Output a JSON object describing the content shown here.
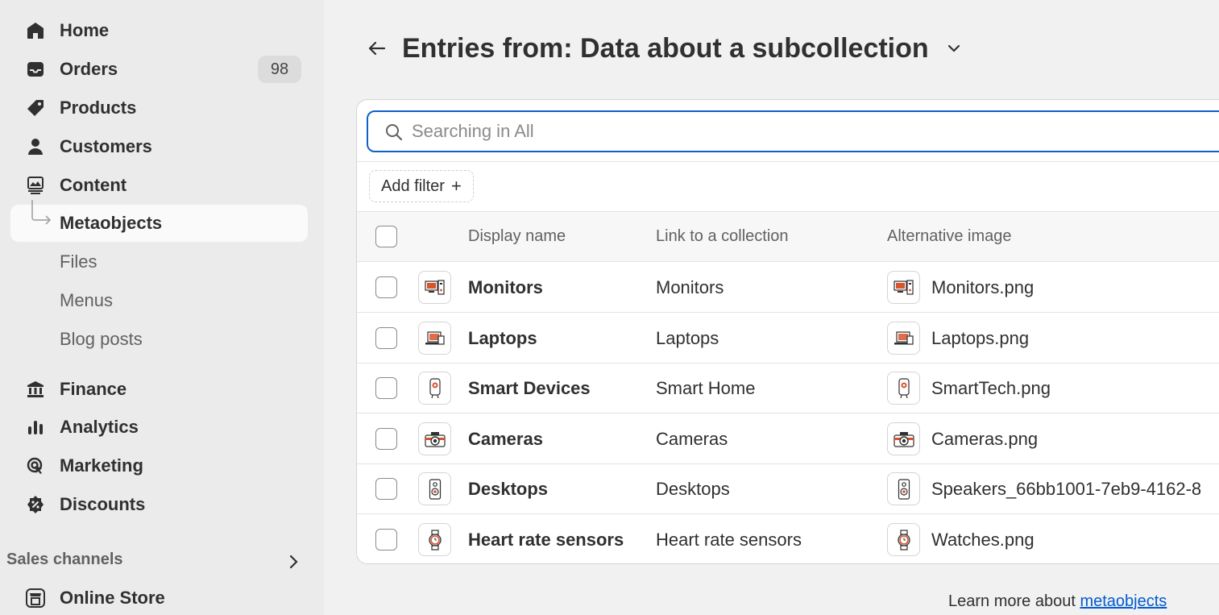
{
  "sidebar": {
    "items": [
      {
        "label": "Home",
        "icon": "home-icon"
      },
      {
        "label": "Orders",
        "icon": "inbox-icon",
        "badge": "98"
      },
      {
        "label": "Products",
        "icon": "tag-icon"
      },
      {
        "label": "Customers",
        "icon": "person-icon"
      },
      {
        "label": "Content",
        "icon": "image-icon"
      },
      {
        "label": "Metaobjects",
        "icon": "subitem-arrow-icon",
        "active": true
      },
      {
        "label": "Files"
      },
      {
        "label": "Menus"
      },
      {
        "label": "Blog posts"
      },
      {
        "label": "Finance",
        "icon": "bank-icon"
      },
      {
        "label": "Analytics",
        "icon": "bar-chart-icon"
      },
      {
        "label": "Marketing",
        "icon": "target-icon"
      },
      {
        "label": "Discounts",
        "icon": "discount-icon"
      }
    ],
    "sales_channels": {
      "title": "Sales channels",
      "items": [
        {
          "label": "Online Store",
          "icon": "store-icon"
        }
      ]
    }
  },
  "header": {
    "title": "Entries from:  Data about a subcollection"
  },
  "search": {
    "placeholder": "Searching in All"
  },
  "filter": {
    "label": "Add filter",
    "plus": "+"
  },
  "table": {
    "columns": [
      "Display name",
      "Link to a collection",
      "Alternative image"
    ],
    "rows": [
      {
        "name": "Monitors",
        "link": "Monitors",
        "image": "Monitors.png",
        "icon": "monitor-icon"
      },
      {
        "name": "Laptops",
        "link": "Laptops",
        "image": "Laptops.png",
        "icon": "laptop-icon"
      },
      {
        "name": "Smart Devices",
        "link": "Smart Home",
        "image": "SmartTech.png",
        "icon": "smart-device-icon"
      },
      {
        "name": "Cameras",
        "link": "Cameras",
        "image": "Cameras.png",
        "icon": "camera-icon"
      },
      {
        "name": "Desktops",
        "link": "Desktops",
        "image": "Speakers_66bb1001-7eb9-4162-8",
        "icon": "speaker-icon"
      },
      {
        "name": "Heart rate sensors",
        "link": "Heart rate sensors",
        "image": "Watches.png",
        "icon": "watch-icon"
      }
    ]
  },
  "footer": {
    "prefix": "Learn more about ",
    "link": "metaobjects"
  },
  "colors": {
    "accent": "#1060c8",
    "link": "#005bd3",
    "thumb_accent": "#d8542c"
  }
}
